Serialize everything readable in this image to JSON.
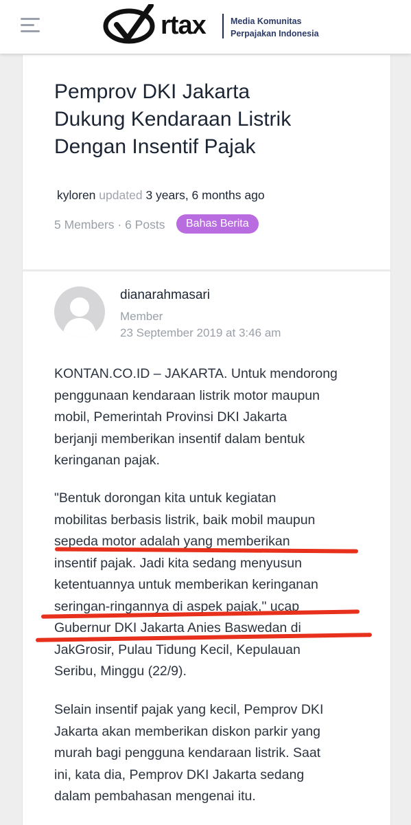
{
  "header": {
    "menu_icon": "hamburger-menu-icon",
    "logo_text": "rtax",
    "logo_mark": "O",
    "tagline_line1": "Media Komunitas",
    "tagline_line2": "Perpajakan Indonesia"
  },
  "topic": {
    "title_lines": [
      "Pemprov DKI Jakarta",
      "Dukung Kendaraan Listrik",
      "Dengan Insentif Pajak"
    ],
    "updated_user": "kyloren",
    "updated_word": "updated",
    "updated_time": "3 years, 6 months ago",
    "meta": "5 Members · 6 Posts",
    "tag": "Bahas Berita"
  },
  "post": {
    "author": "dianarahmasari",
    "role": "Member",
    "date": "23 September 2019 at 3:46 am",
    "paragraphs": [
      [
        "KONTAN.CO.ID – JAKARTA. Untuk mendorong",
        "penggunaan kendaraan listrik motor maupun",
        "mobil, Pemerintah Provinsi DKI Jakarta",
        "berjanji memberikan insentif dalam bentuk",
        "keringanan pajak."
      ],
      [
        "\"Bentuk dorongan kita untuk kegiatan",
        "mobilitas berbasis listrik, baik mobil maupun",
        "sepeda motor adalah yang memberikan",
        "insentif pajak. Jadi kita sedang menyusun",
        "ketentuannya untuk memberikan keringanan",
        "seringan-ringannya di aspek pajak,\" ucap",
        "Gubernur DKI Jakarta Anies Baswedan di",
        "JakGrosir, Pulau Tidung Kecil, Kepulauan",
        "Seribu, Minggu (22/9)."
      ],
      [
        "Selain insentif pajak yang kecil, Pemprov DKI",
        "Jakarta akan memberikan diskon parkir yang",
        "murah bagi pengguna kendaraan listrik. Saat",
        "ini, kata dia, Pemprov DKI Jakarta sedang",
        "dalam pembahasan mengenai itu."
      ]
    ],
    "annotation_color": "#e8311c"
  }
}
